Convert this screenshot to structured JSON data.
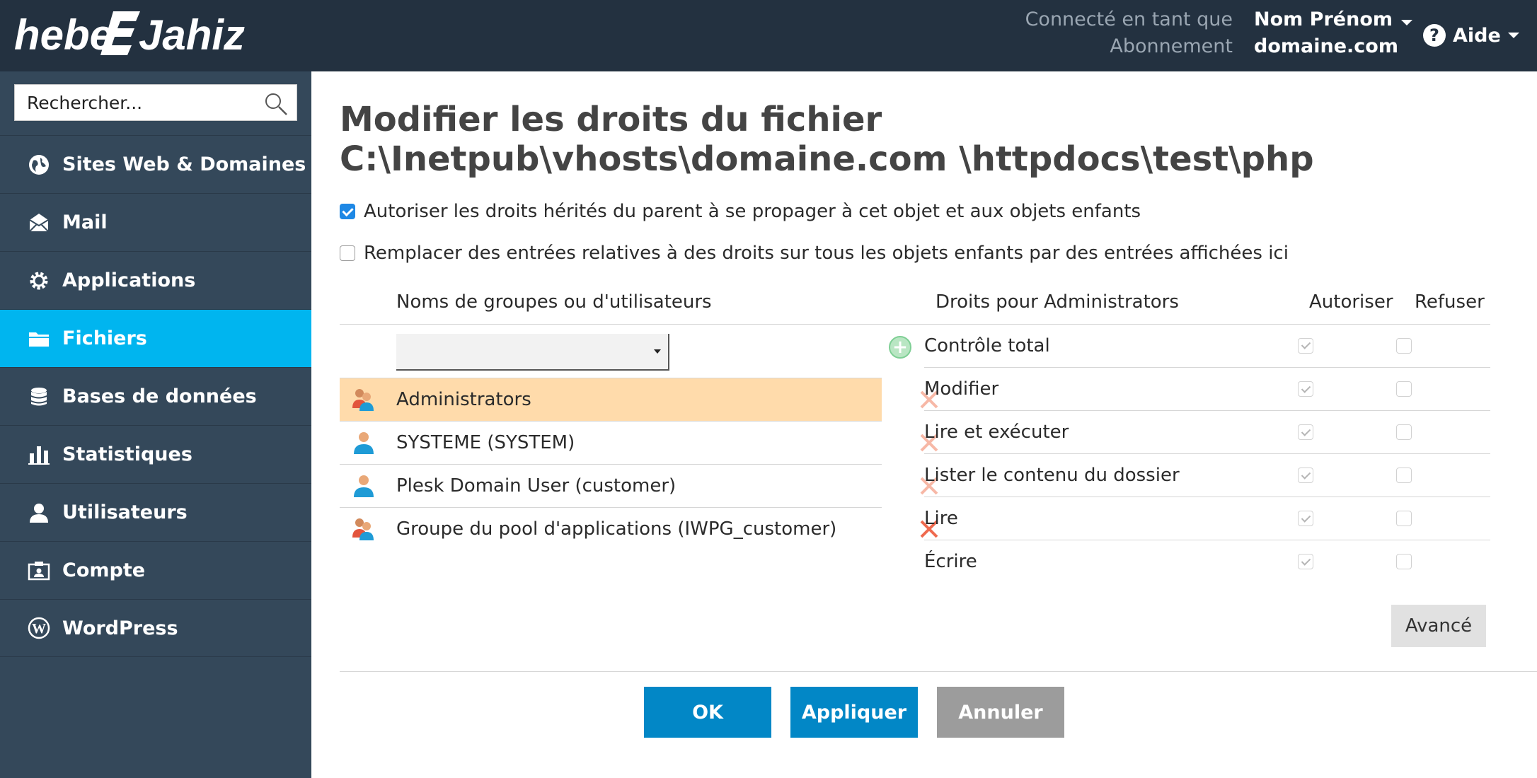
{
  "header": {
    "logo_text": "hebergeur-jahiz",
    "logged_label": "Connecté en tant que",
    "user_name": "Nom Prénom",
    "subscription_label": "Abonnement",
    "subscription_value": "domaine.com",
    "help_label": "Aide",
    "help_icon": "question-circle-icon",
    "bg_color": "#233140"
  },
  "sidebar": {
    "search_placeholder": "Rechercher...",
    "items": [
      {
        "label": "Sites Web & Domaines",
        "icon": "globe-icon"
      },
      {
        "label": "Mail",
        "icon": "envelope-icon"
      },
      {
        "label": "Applications",
        "icon": "gear-icon"
      },
      {
        "label": "Fichiers",
        "icon": "folder-icon",
        "active": true
      },
      {
        "label": "Bases de données",
        "icon": "database-icon"
      },
      {
        "label": "Statistiques",
        "icon": "bar-chart-icon"
      },
      {
        "label": "Utilisateurs",
        "icon": "user-icon"
      },
      {
        "label": "Compte",
        "icon": "id-card-icon"
      },
      {
        "label": "WordPress",
        "icon": "wordpress-icon"
      }
    ],
    "bg_color": "#34485a",
    "active_color": "#00b5ef"
  },
  "main": {
    "title": "Modifier les droits du fichier C:\\Inetpub\\vhosts\\domaine.com \\httpdocs\\test\\php",
    "inherit_checkbox": {
      "label": "Autoriser les droits hérités du parent à se propager à cet objet et aux objets enfants",
      "checked": true
    },
    "replace_checkbox": {
      "label": "Remplacer des entrées relatives à des droits sur tous les objets enfants par des entrées affichées ici",
      "checked": false
    },
    "users_header": "Noms de groupes ou d'utilisateurs",
    "rights_header": "Droits pour Administrators",
    "allow_header": "Autoriser",
    "deny_header": "Refuser",
    "users": [
      {
        "name": "Administrators",
        "icon": "group-icon",
        "selected": true
      },
      {
        "name": "SYSTEME (SYSTEM)",
        "icon": "user-icon",
        "selected": false
      },
      {
        "name": "Plesk Domain User (customer)",
        "icon": "user-icon",
        "selected": false
      },
      {
        "name": "Groupe du pool d'applications (IWPG_customer)",
        "icon": "group-icon",
        "selected": false
      }
    ],
    "rights": [
      {
        "label": "Contrôle total",
        "allow": true,
        "deny": false
      },
      {
        "label": "Modifier",
        "allow": true,
        "deny": false
      },
      {
        "label": "Lire et exécuter",
        "allow": true,
        "deny": false
      },
      {
        "label": "Lister le contenu du dossier",
        "allow": true,
        "deny": false
      },
      {
        "label": "Lire",
        "allow": true,
        "deny": false
      },
      {
        "label": "Écrire",
        "allow": true,
        "deny": false
      }
    ],
    "advanced_label": "Avancé",
    "ok_label": "OK",
    "apply_label": "Appliquer",
    "cancel_label": "Annuler",
    "selected_row_color": "#ffdbab",
    "primary_button_color": "#0287c6"
  }
}
